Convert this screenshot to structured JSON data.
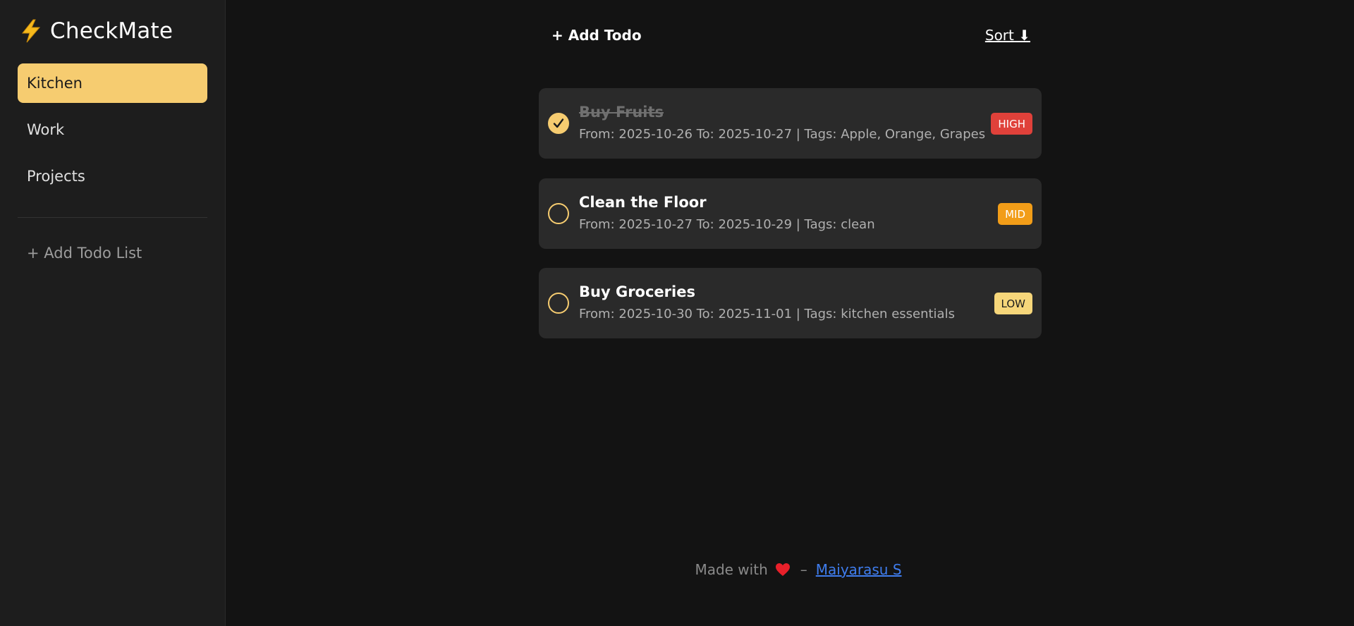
{
  "app": {
    "brand_icon": "lightning-bolt-icon",
    "title": "CheckMate"
  },
  "sidebar": {
    "lists": [
      {
        "label": "Kitchen",
        "active": true
      },
      {
        "label": "Work",
        "active": false
      },
      {
        "label": "Projects",
        "active": false
      }
    ],
    "add_list_label": "+ Add Todo List"
  },
  "toolbar": {
    "add_todo_label": "+ Add Todo",
    "sort_label": "Sort ⬇"
  },
  "todos": [
    {
      "title": "Buy Fruits",
      "meta": "From: 2025-10-26 To: 2025-10-27 | Tags: Apple, Orange, Grapes",
      "priority": "HIGH",
      "done": true
    },
    {
      "title": "Clean the Floor",
      "meta": "From: 2025-10-27 To: 2025-10-29 | Tags: clean",
      "priority": "MID",
      "done": false
    },
    {
      "title": "Buy Groceries",
      "meta": "From: 2025-10-30 To: 2025-11-01 | Tags: kitchen essentials",
      "priority": "LOW",
      "done": false
    }
  ],
  "footer": {
    "made_with": "Made with",
    "heart_icon": "heart-icon",
    "separator": "–",
    "author": "Maiyarasu S"
  },
  "colors": {
    "accent": "#f6cc70",
    "background": "#131313",
    "sidebar": "#1d1d1d",
    "card": "#2a2a2a",
    "high": "#e0413a",
    "mid": "#f29d18",
    "low": "#f6d67a",
    "link": "#3f7dee"
  }
}
